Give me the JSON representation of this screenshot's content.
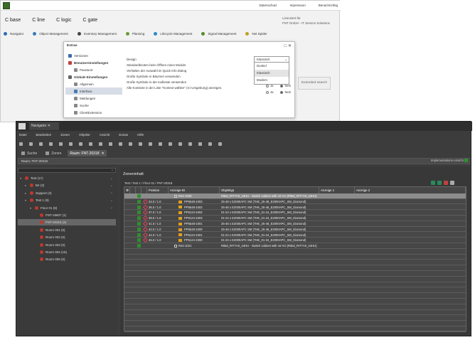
{
  "back": {
    "links": [
      "Datenschutz",
      "Impressum",
      "Benachrichtig"
    ],
    "products": [
      "C base",
      "C line",
      "C logic",
      "C gate"
    ],
    "license_line1": "Lizensiert für",
    "license_line2": "FNT GmbH - IT Service Solutions",
    "modules": [
      "Navigator",
      "Object Management",
      "Inventory Management",
      "Planning",
      "Lifecycle Management",
      "Signal Management",
      "Net Spider"
    ],
    "extended_search": "Extended search"
  },
  "dialog": {
    "title": "Extras",
    "nav": [
      "Versionen",
      "Benutzereinstellungen",
      "Passwort",
      "Globale Einstellungen",
      "Allgemein",
      "Interface",
      "Meldungen",
      "Suche",
      "ClientExtension"
    ],
    "form": [
      "Design",
      "Standardknoten beim Öffnen eines Moduls",
      "Verhalten der Auswahl im Quick Info Dialog",
      "Große Symbole in Bäumen verwenden",
      "Große Symbole in der toolleiste verwenden",
      "Alle Kontexte in der Liste \"Kontext wählen\" (CI Umgebung) anzeigen."
    ],
    "dropdown_selected": "Klassisch",
    "dropdown_options": [
      "Dunkel",
      "Klassisch",
      "Modern"
    ],
    "radio_yes": "Ja",
    "radio_no": "Nein"
  },
  "front": {
    "tab": "Navigator",
    "menu": [
      "Datei",
      "Bearbeiten",
      "Zonen",
      "Objekte",
      "Ansicht",
      "Extras",
      "Hilfe"
    ],
    "wtabs": [
      "Suche",
      "Zonen",
      "Raum: FNT-20318"
    ],
    "crumb": "Raum: FNT-20318",
    "imp_label": "Implementations-Ansicht",
    "tree": [
      {
        "label": "Test (17)",
        "level": 0,
        "open": true,
        "chev": true
      },
      {
        "label": "B4 (3)",
        "level": 1,
        "open": false,
        "chev": true
      },
      {
        "label": "Support (3)",
        "level": 1,
        "open": false,
        "chev": true
      },
      {
        "label": "Test 1 (8)",
        "level": 1,
        "open": true,
        "chev": true
      },
      {
        "label": "Floor 01 (8)",
        "level": 2,
        "open": true,
        "chev": true
      },
      {
        "label": "FNT-19607 (1)",
        "level": 3,
        "open": false,
        "chev": false
      },
      {
        "label": "FNT-20318 (2)",
        "level": 3,
        "open": false,
        "chev": false,
        "selected": true
      },
      {
        "label": "Room 001 (0)",
        "level": 3,
        "open": false,
        "chev": false
      },
      {
        "label": "Room 002 (0)",
        "level": 3,
        "open": false,
        "chev": false
      },
      {
        "label": "Room 003 (0)",
        "level": 3,
        "open": false,
        "chev": false
      },
      {
        "label": "Room 004 (15)",
        "level": 3,
        "open": false,
        "chev": false
      },
      {
        "label": "Room 005 (0)",
        "level": 3,
        "open": false,
        "chev": false
      }
    ],
    "main_title": "Zoneninhalt",
    "path": "Test / Test 1 / Floor 01 / FNT-20318",
    "headers": [
      "Position",
      "Anzeige-ID",
      "Objekttyp",
      "Anzeige 1",
      "Anzeige 2"
    ],
    "rows": [
      {
        "pos": "",
        "id": "R42-1020",
        "type": "Rittal_RIT7A0_44HU - Switch cabinet with 44 HU (Rittal_RIT7A0_44HU)",
        "kind": "cab",
        "hl": true
      },
      {
        "pos": "34.0 / 1.0",
        "id": "PP5548-1003",
        "type": "25-48 x E2000APC SM (THE_25-48_E2000APC_SM_Diamond)",
        "kind": "pp"
      },
      {
        "pos": "36.0 / 1.0",
        "id": "PP5548-1002",
        "type": "25-48 x E2000APC SM (THE_25-48_E2000APC_SM_Diamond)",
        "kind": "pp"
      },
      {
        "pos": "37.0 / 1.0",
        "id": "PP5124-1002",
        "type": "01-24 x E2000APC SM (THE_01-24_E2000APC_SM_Diamond)",
        "kind": "pp"
      },
      {
        "pos": "38.0 / 1.0",
        "id": "PP5124-1003",
        "type": "01-24 x E2000APC SM (THE_01-24_E2000APC_SM_Diamond)",
        "kind": "pp"
      },
      {
        "pos": "41.0 / 1.0",
        "id": "PP5548-1001",
        "type": "25-48 x E2000APC SM (THE_25-48_E2000APC_SM_Diamond)",
        "kind": "pp"
      },
      {
        "pos": "42.0 / 1.0",
        "id": "PP5548-1000",
        "type": "25-48 x E2000APC SM (THE_25-48_E2000APC_SM_Diamond)",
        "kind": "pp"
      },
      {
        "pos": "44.0 / 1.0",
        "id": "PP5124-1001",
        "type": "01-24 x E2000APC SM (THE_01-24_E2000APC_SM_Diamond)",
        "kind": "pp"
      },
      {
        "pos": "45.0 / 1.0",
        "id": "PP5124-1000",
        "type": "01-24 x E2000APC SM (THE_01-24_E2000APC_SM_Diamond)",
        "kind": "pp"
      },
      {
        "pos": "",
        "id": "R42-1021",
        "type": "Rittal_RIT7A0_44HU - Switch cabinet with 44 HU (Rittal_RIT7A0_44HU)",
        "kind": "cab"
      }
    ]
  }
}
